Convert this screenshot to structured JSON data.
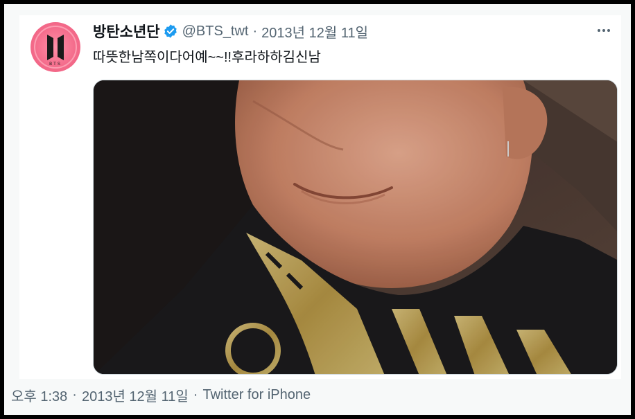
{
  "tweet": {
    "author": {
      "display_name": "방탄소년단",
      "handle": "@BTS_twt",
      "verified": true,
      "avatar_text": "BTS",
      "avatar_icon": "bts-logo-icon"
    },
    "separator": "·",
    "date_short": "2013년 12월 11일",
    "text": "따뜻한남쪽이다어예~~!!후라하하김신남",
    "more_icon": "more-dots-icon",
    "media": {
      "type": "photo",
      "icon": "photo"
    },
    "footer": {
      "time": "오후 1:38",
      "date": "2013년 12월 11일",
      "source": "Twitter for iPhone"
    }
  },
  "colors": {
    "text_primary": "#0f1419",
    "text_secondary": "#536471",
    "verified_blue": "#1d9bf0",
    "avatar_pink": "#f46d8c",
    "frame": "#000000"
  }
}
